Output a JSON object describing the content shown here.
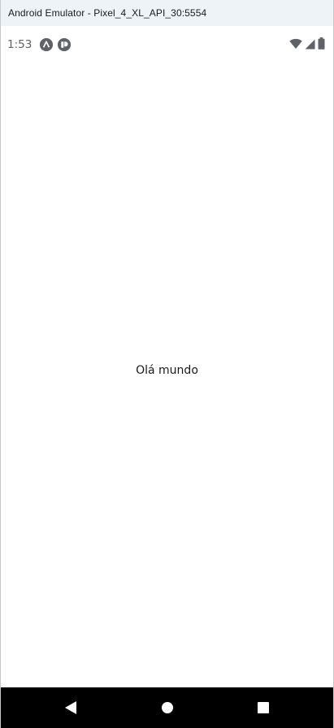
{
  "window": {
    "title": "Android Emulator - Pixel_4_XL_API_30:5554"
  },
  "statusbar": {
    "time": "1:53",
    "notification_icons": [
      "android-studio-icon",
      "debug-icon"
    ],
    "system_icons": [
      "wifi-icon",
      "cellular-signal-icon",
      "battery-icon"
    ]
  },
  "main": {
    "text": "Olá mundo"
  },
  "navbar": {
    "buttons": [
      "back-button",
      "home-button",
      "recents-button"
    ]
  },
  "colors": {
    "titlebar_bg": "#eef3f8",
    "status_icon": "#5f6368",
    "navbar_bg": "#000000"
  }
}
